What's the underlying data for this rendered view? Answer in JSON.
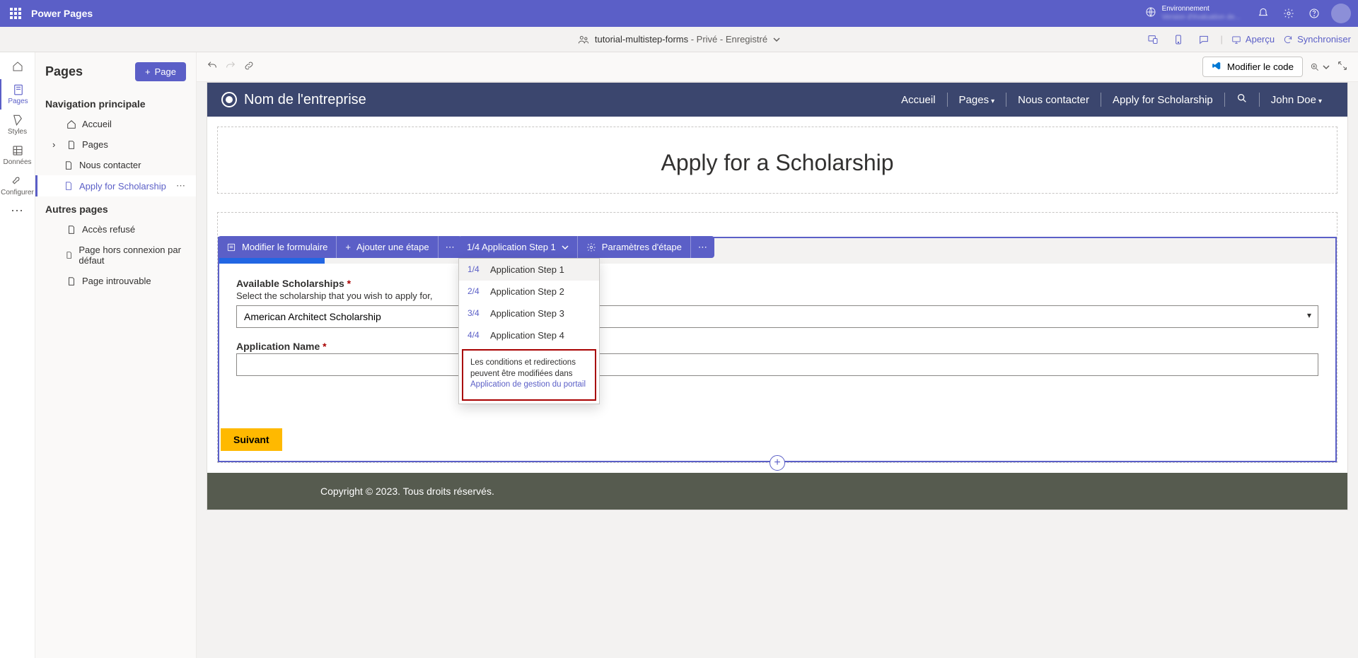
{
  "header": {
    "app_title": "Power Pages",
    "environment_label": "Environnement",
    "environment_name": "Version d'évaluation de..."
  },
  "docbar": {
    "site_name": "tutorial-multistep-forms",
    "visibility": " - Privé",
    "saved_status": " - Enregistré",
    "preview": "Aperçu",
    "sync": "Synchroniser"
  },
  "rail": {
    "pages": "Pages",
    "styles": "Styles",
    "data": "Données",
    "configure": "Configurer"
  },
  "pages_panel": {
    "title": "Pages",
    "add_page": "Page",
    "nav_section": "Navigation principale",
    "other_section": "Autres pages",
    "items": {
      "home": "Accueil",
      "pages": "Pages",
      "contact": "Nous contacter",
      "apply": "Apply for Scholarship",
      "denied": "Accès refusé",
      "offline": "Page hors connexion par défaut",
      "notfound": "Page introuvable"
    }
  },
  "canvas_toolbar": {
    "edit_code": "Modifier le code"
  },
  "site": {
    "brand": "Nom de l'entreprise",
    "nav": {
      "home": "Accueil",
      "pages": "Pages",
      "contact": "Nous contacter",
      "apply": "Apply for Scholarship",
      "user": "John Doe"
    },
    "heading": "Apply for a Scholarship",
    "footer": "Copyright © 2023. Tous droits réservés."
  },
  "form_toolbar": {
    "edit": "Modifier le formulaire",
    "add_step": "Ajouter une étape",
    "current_step": "1/4 Application Step 1",
    "settings": "Paramètres d'étape"
  },
  "tabs": {
    "t1": "Application Step 1",
    "t2": "Application Step 2",
    "t3": "Application S"
  },
  "form": {
    "scholarships_label": "Available Scholarships",
    "scholarships_help": "Select the scholarship that you wish to apply for,",
    "scholarships_value": "American Architect Scholarship",
    "appname_label": "Application Name",
    "next_btn": "Suivant"
  },
  "dropdown": {
    "items": [
      {
        "prefix": "1/4",
        "label": "Application Step 1"
      },
      {
        "prefix": "2/4",
        "label": "Application Step 2"
      },
      {
        "prefix": "3/4",
        "label": "Application Step 3"
      },
      {
        "prefix": "4/4",
        "label": "Application Step 4"
      }
    ],
    "note_text": "Les conditions et redirections peuvent être modifiées dans ",
    "note_link": "Application de gestion du portail"
  }
}
